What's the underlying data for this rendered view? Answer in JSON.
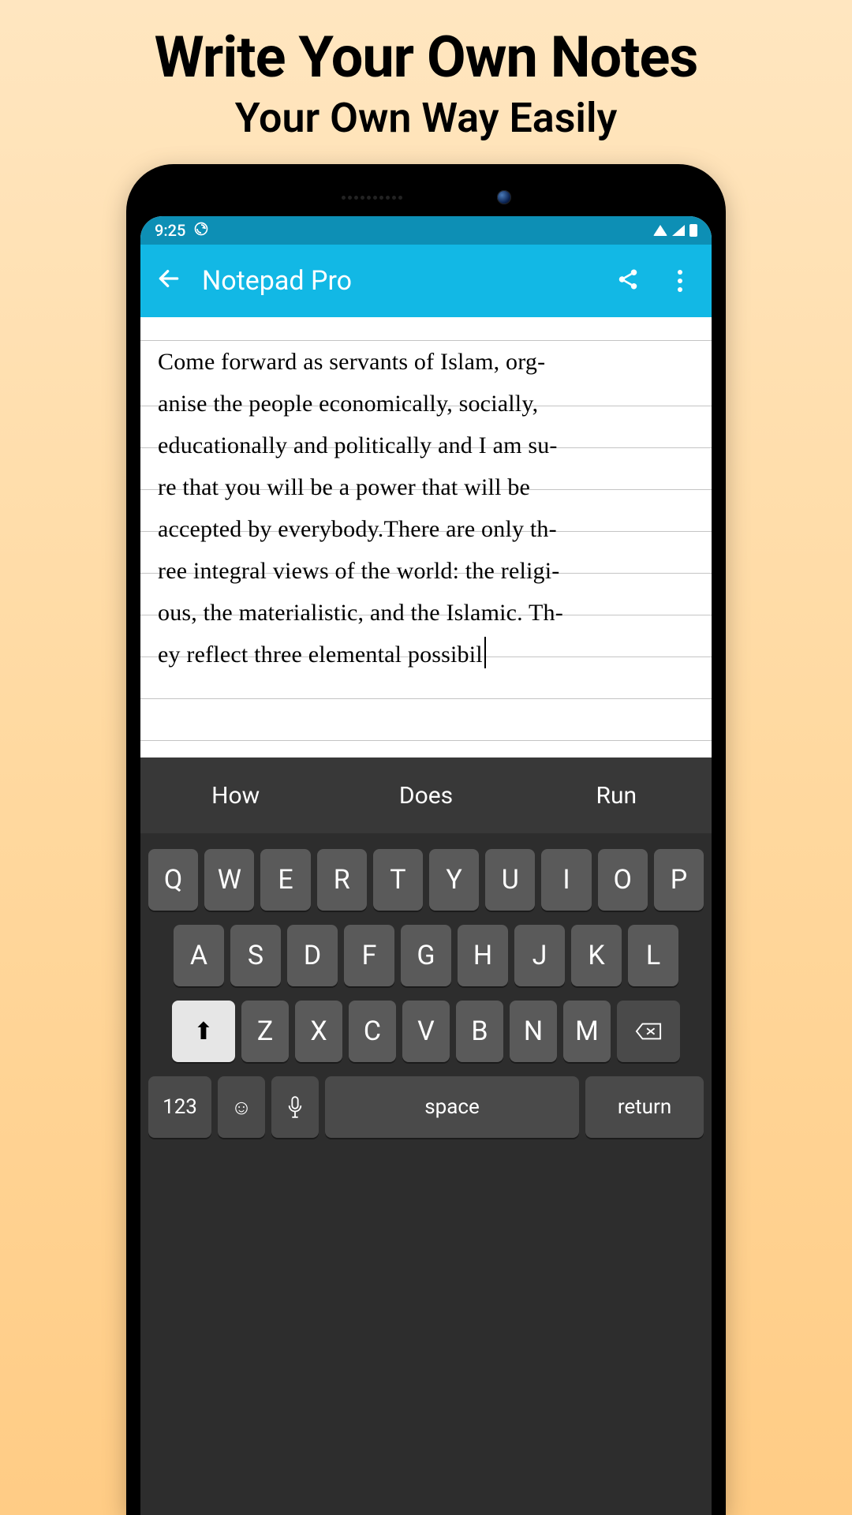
{
  "promo": {
    "headline": "Write Your Own Notes",
    "subhead": "Your Own Way Easily"
  },
  "statusbar": {
    "time": "9:25",
    "sync_icon": "sync"
  },
  "appbar": {
    "title": "Notepad Pro"
  },
  "note": {
    "text": "Come forward as servants of Islam, org-\nanise the people economically, socially,\neducationally and politically and I am su-\nre that you will be a power that will be\naccepted by everybody.There are only th-\nree integral views of the world: the religi-\nous, the materialistic, and the Islamic. Th-\ney reflect three elemental possibil"
  },
  "suggestions": [
    "How",
    "Does",
    "Run"
  ],
  "keyboard": {
    "row1": [
      "Q",
      "W",
      "E",
      "R",
      "T",
      "Y",
      "U",
      "I",
      "O",
      "P"
    ],
    "row2": [
      "A",
      "S",
      "D",
      "F",
      "G",
      "H",
      "J",
      "K",
      "L"
    ],
    "row3": [
      "Z",
      "X",
      "C",
      "V",
      "B",
      "N",
      "M"
    ],
    "numKey": "123",
    "spaceLabel": "space",
    "returnLabel": "return"
  }
}
